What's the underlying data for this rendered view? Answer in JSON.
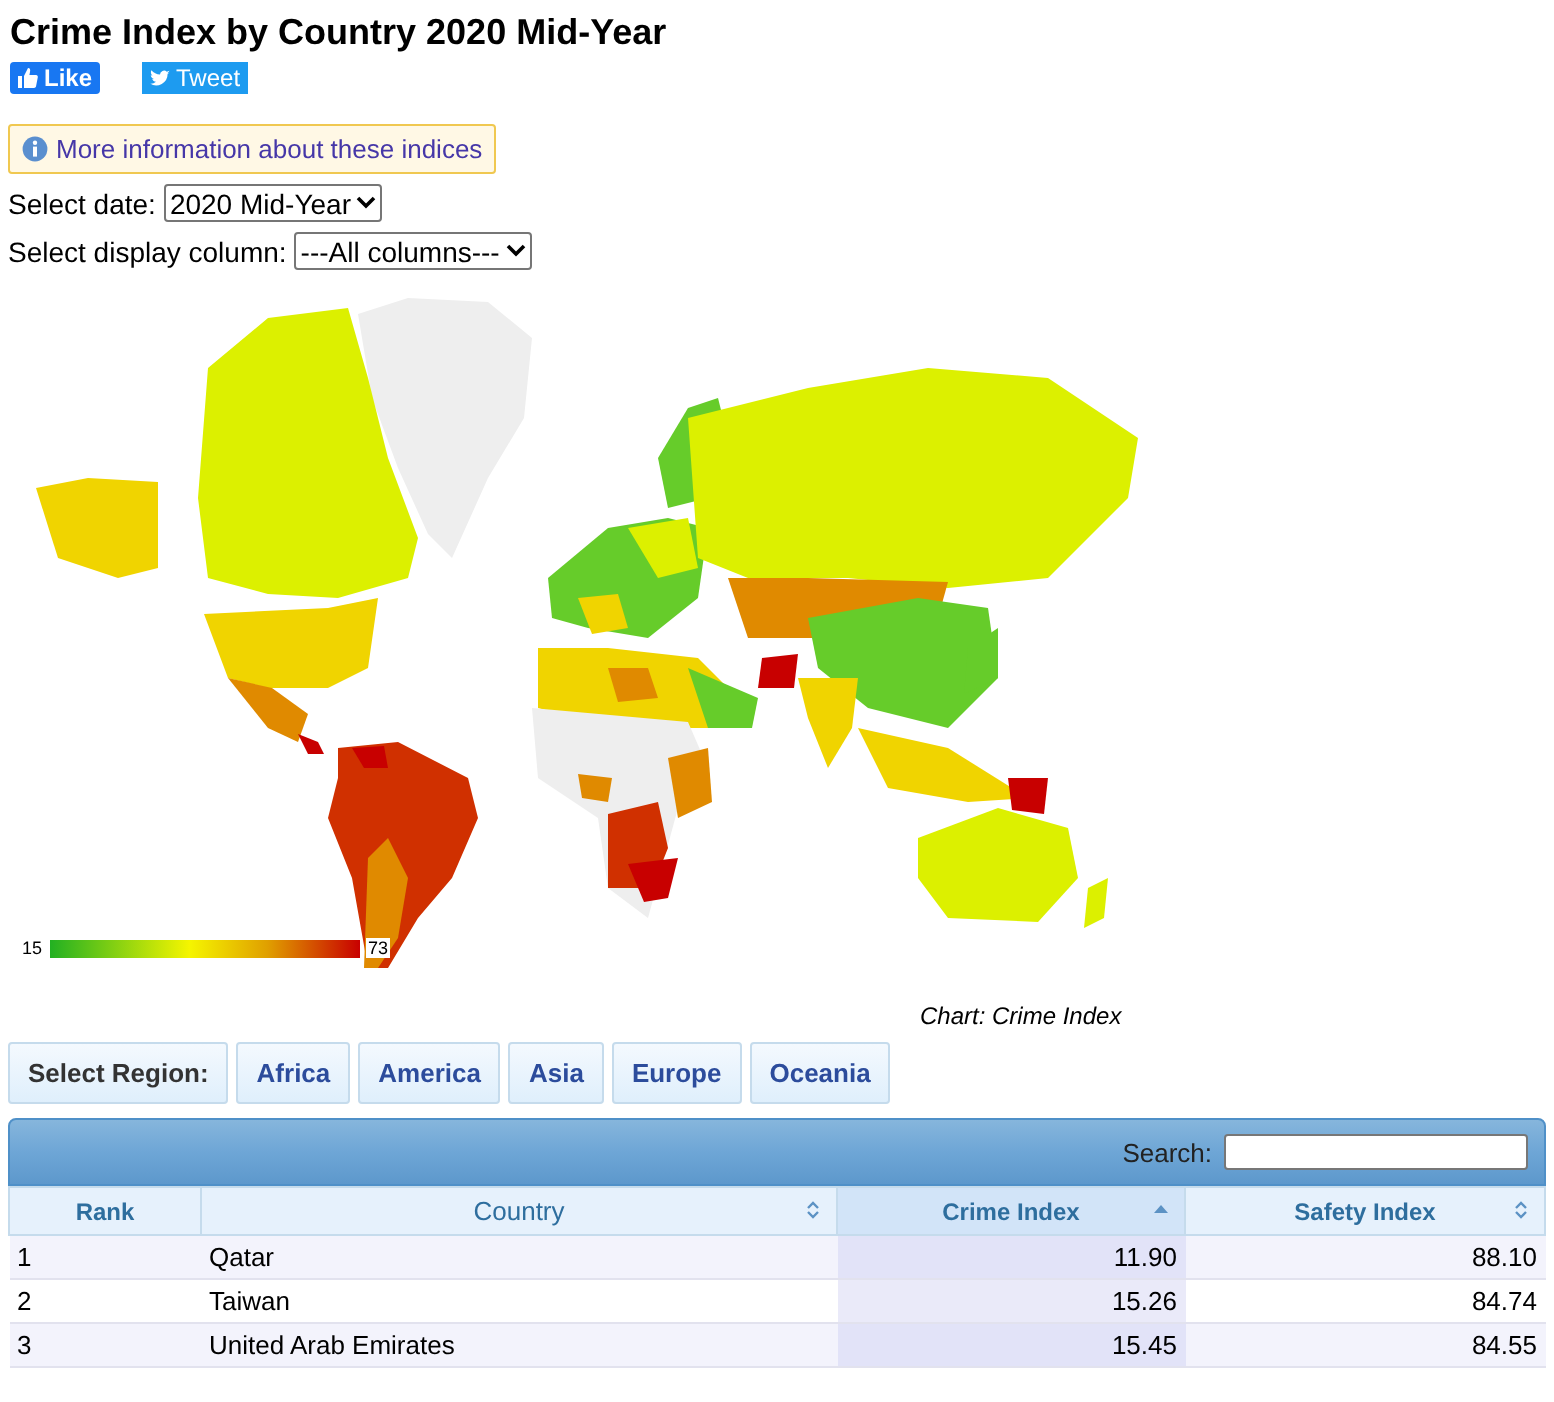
{
  "title": "Crime Index by Country 2020 Mid-Year",
  "social": [
    {
      "kind": "like",
      "label": "Like"
    },
    {
      "kind": "tweet",
      "label": "Tweet"
    }
  ],
  "info_link": "More information about these indices",
  "date_select": {
    "label": "Select date:",
    "value": "2020 Mid-Year"
  },
  "column_select": {
    "label": "Select display column:",
    "value": "---All columns---"
  },
  "map": {
    "legend_min": "15",
    "legend_max": "73",
    "caption": "Chart: Crime Index"
  },
  "region_bar": {
    "label": "Select Region:",
    "regions": [
      "Africa",
      "America",
      "Asia",
      "Europe",
      "Oceania"
    ]
  },
  "table": {
    "search_label": "Search:",
    "columns": [
      {
        "label": "Rank",
        "sortable": false,
        "sorted": false
      },
      {
        "label": "Country",
        "sortable": true,
        "sorted": false
      },
      {
        "label": "Crime Index",
        "sortable": true,
        "sorted": true
      },
      {
        "label": "Safety Index",
        "sortable": true,
        "sorted": false
      }
    ],
    "rows": [
      [
        "1",
        "Qatar",
        "11.90",
        "88.10"
      ],
      [
        "2",
        "Taiwan",
        "15.26",
        "84.74"
      ],
      [
        "3",
        "United Arab Emirates",
        "15.45",
        "84.55"
      ]
    ]
  }
}
